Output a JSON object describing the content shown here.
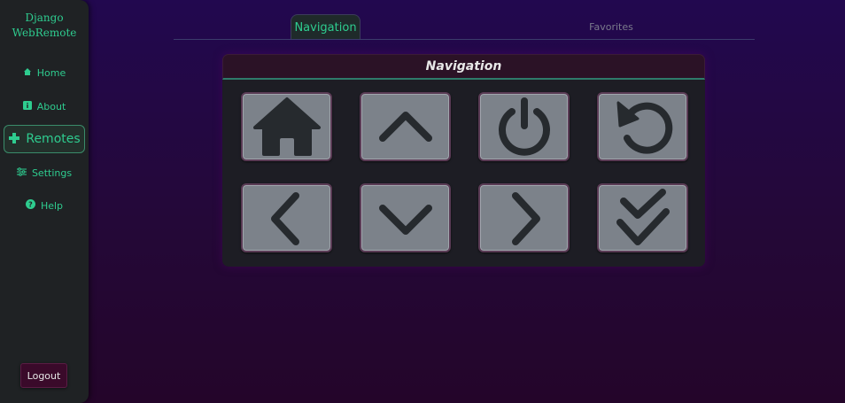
{
  "sidebar": {
    "brand_line1": "Django",
    "brand_line2": "WebRemote",
    "items": [
      {
        "label": "Home",
        "icon": "home-icon"
      },
      {
        "label": "About",
        "icon": "info-icon"
      },
      {
        "label": "Remotes",
        "icon": "gamepad-plus-icon"
      },
      {
        "label": "Settings",
        "icon": "sliders-icon"
      },
      {
        "label": "Help",
        "icon": "question-circle-icon"
      }
    ],
    "logout_label": "Logout"
  },
  "tabs": [
    {
      "label": "Navigation",
      "active": true
    },
    {
      "label": "Favorites",
      "active": false
    }
  ],
  "panel": {
    "title": "Navigation",
    "buttons": [
      {
        "icon": "home-icon"
      },
      {
        "icon": "chevron-up-icon"
      },
      {
        "icon": "power-icon"
      },
      {
        "icon": "undo-icon"
      },
      {
        "icon": "chevron-left-icon"
      },
      {
        "icon": "chevron-down-icon"
      },
      {
        "icon": "chevron-right-icon"
      },
      {
        "icon": "double-check-icon"
      }
    ]
  },
  "colors": {
    "accent": "#2ecc8f",
    "sidebar_bg": "#1f2224",
    "button_bg": "#7c828a",
    "icon_color": "#262a2e"
  }
}
